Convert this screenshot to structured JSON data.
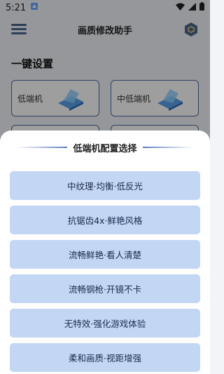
{
  "status_bar": {
    "time": "5:21"
  },
  "header": {
    "title": "画质修改助手"
  },
  "section": {
    "title": "一键设置"
  },
  "cards": [
    {
      "label": "低端机"
    },
    {
      "label": "中低端机"
    }
  ],
  "sheet": {
    "title": "低端机配置选择",
    "options": [
      "中纹理·均衡·低反光",
      "抗锯齿4x·鲜艳风格",
      "流畅鲜艳·看人清楚",
      "流畅钢枪·开镜不卡",
      "无特效·强化游戏体验",
      "柔和画质·视距增强"
    ]
  },
  "colors": {
    "accent": "#4a6aa0",
    "option_bg": "#c3d7f5",
    "background": "#f2f4f8"
  }
}
